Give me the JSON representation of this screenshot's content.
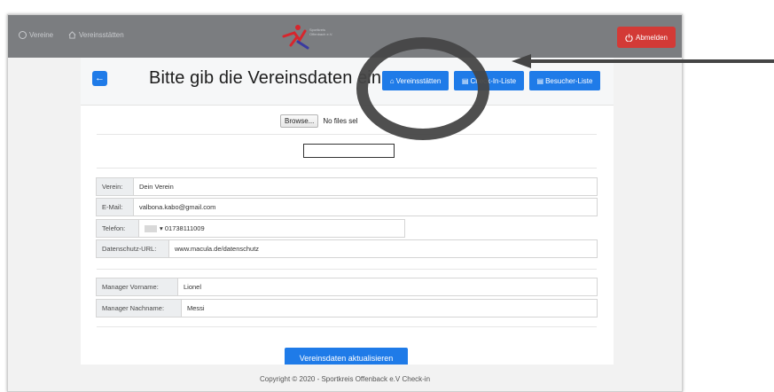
{
  "nav": {
    "item1": "Vereine",
    "item2": "Vereinsstätten",
    "logout": "Abmelden",
    "logo_lines": [
      "Sportkreis",
      "Offenbach e.V."
    ]
  },
  "header": {
    "title": "Bitte gib die Vereinsdaten ein",
    "btn_venues": "Vereinsstätten",
    "btn_checkin": "Check-In-Liste",
    "btn_visitors": "Besucher-Liste"
  },
  "file": {
    "browse": "Browse...",
    "status": "No files sel"
  },
  "form": {
    "verein_label": "Verein:",
    "verein_value": "Dein Verein",
    "email_label": "E-Mail:",
    "email_value": "valbona.kabo@gmail.com",
    "phone_label": "Telefon:",
    "phone_value": "01738111009",
    "privacy_label": "Datenschutz-URL:",
    "privacy_value": "www.macula.de/datenschutz",
    "mgr_first_label": "Manager Vorname:",
    "mgr_first_value": "Lionel",
    "mgr_last_label": "Manager Nachname:",
    "mgr_last_value": "Messi",
    "submit": "Vereinsdaten aktualisieren"
  },
  "footer": {
    "text": "Copyright © 2020 - Sportkreis Offenback e.V Check-in"
  },
  "colors": {
    "primary": "#1f7be8",
    "danger": "#d33a36",
    "navbar": "#7b7d80"
  }
}
